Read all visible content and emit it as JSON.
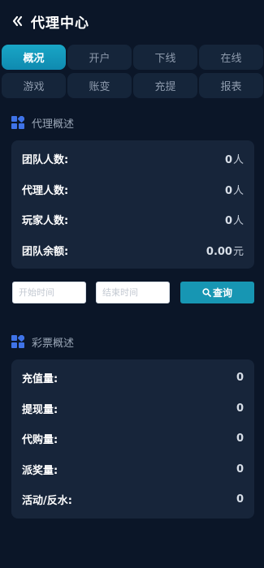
{
  "header": {
    "title": "代理中心",
    "back_icon": "chevron-double-left-icon"
  },
  "tabs": [
    {
      "label": "概况",
      "active": true
    },
    {
      "label": "开户",
      "active": false
    },
    {
      "label": "下线",
      "active": false
    },
    {
      "label": "在线",
      "active": false
    },
    {
      "label": "游戏",
      "active": false
    },
    {
      "label": "账变",
      "active": false
    },
    {
      "label": "充提",
      "active": false
    },
    {
      "label": "报表",
      "active": false
    }
  ],
  "agent_overview": {
    "title": "代理概述",
    "icon": "grid-icon",
    "rows": [
      {
        "label": "团队人数:",
        "value": "0",
        "unit": "人"
      },
      {
        "label": "代理人数:",
        "value": "0",
        "unit": "人"
      },
      {
        "label": "玩家人数:",
        "value": "0",
        "unit": "人"
      },
      {
        "label": "团队余额:",
        "value": "0.00",
        "unit": "元"
      }
    ]
  },
  "filters": {
    "start_placeholder": "开始时间",
    "end_placeholder": "结束时间",
    "query_label": "查询",
    "query_icon": "search-icon"
  },
  "lottery_overview": {
    "title": "彩票概述",
    "icon": "grid-icon",
    "rows": [
      {
        "label": "充值量:",
        "value": "0"
      },
      {
        "label": "提现量:",
        "value": "0"
      },
      {
        "label": "代购量:",
        "value": "0"
      },
      {
        "label": "派奖量:",
        "value": "0"
      },
      {
        "label": "活动/反水:",
        "value": "0"
      }
    ]
  },
  "colors": {
    "background": "#0b1628",
    "card": "#17253a",
    "tab": "#15253a",
    "accent": "#1796b3",
    "icon_blue": "#3f73e8"
  }
}
